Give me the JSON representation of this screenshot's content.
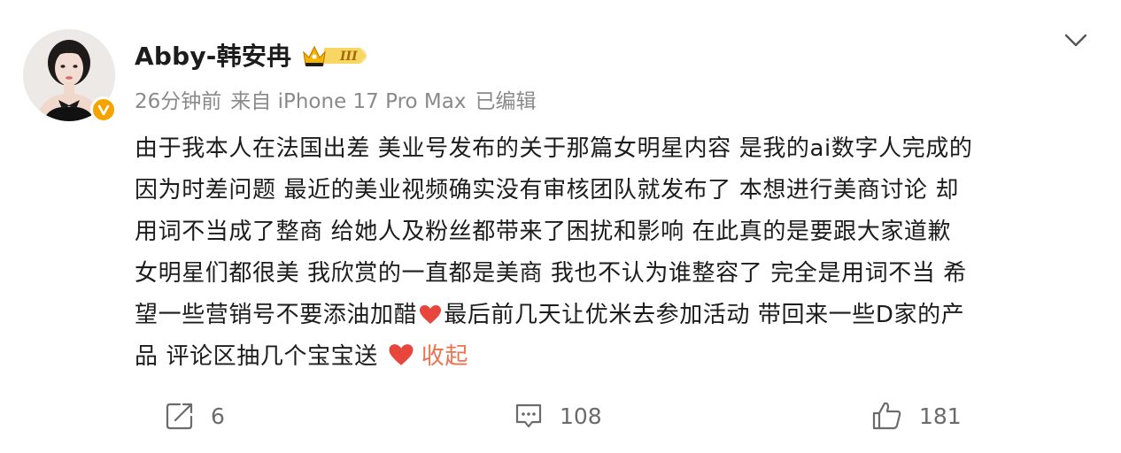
{
  "post": {
    "author": "Abby-韩安冉",
    "meta": {
      "time": "26分钟前",
      "source": "来自 iPhone 17 Pro Max",
      "edited": "已编辑"
    },
    "content_lines": [
      "由于我本人在法国出差 美业号发布的关于那篇女明星内容 是我的ai数字人完成的",
      "因为时差问题 最近的美业视频确实没有审核团队就发布了 本想进行美商讨论 却",
      "用词不当成了整商 给她人及粉丝都带来了困扰和影响 在此真的是要跟大家道歉",
      "女明星们都很美 我欣赏的一直都是美商 我也不认为谁整容了 完全是用词不当 希",
      "望一些营销号不要添油加醋",
      "最后前几天让优米去参加活动 带回来一些D家的产",
      "品 评论区抽几个宝宝送"
    ],
    "collapse_label": "收起",
    "actions": {
      "repost_count": "6",
      "comment_count": "108",
      "like_count": "181"
    }
  },
  "colors": {
    "accent": "#eb7350",
    "verified": "#f6a300",
    "heart": "#e8453c",
    "muted_text": "#8a8a8a"
  },
  "icons": [
    "avatar-photo",
    "verified-badge-icon",
    "crown-level-icon",
    "chevron-down-icon",
    "heart-emoji-icon",
    "repost-icon",
    "comment-icon",
    "like-icon"
  ]
}
